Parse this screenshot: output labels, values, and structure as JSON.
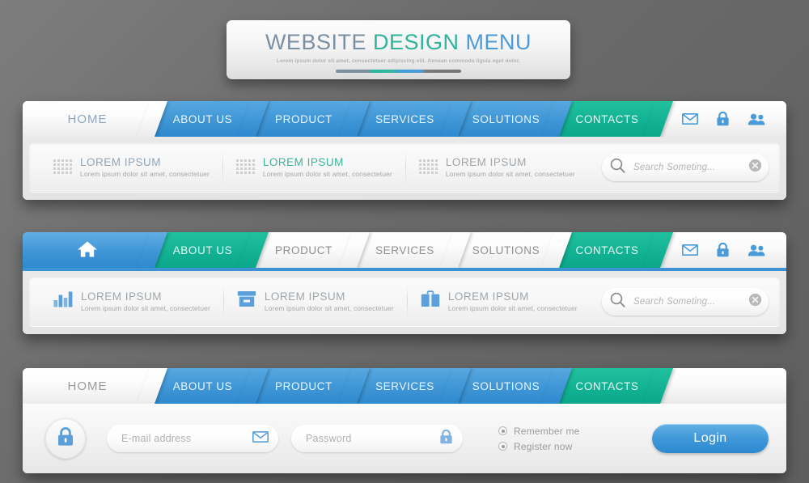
{
  "header": {
    "title_parts": [
      {
        "text": "WEBSITE",
        "cls": "t-website"
      },
      {
        "text": "DESIGN",
        "cls": "t-design"
      },
      {
        "text": "MENU",
        "cls": "t-menu-m"
      }
    ],
    "title_website": "WEBSITE",
    "title_design": "DESIGN",
    "title_menu": "MENU",
    "subtitle": "Lorem ipsum dolor sit amet, consectetuer adipiscing elit. Aenean commodo ligula eget dolor."
  },
  "colors": {
    "blue": "#3f96d6",
    "teal": "#13b294",
    "white_tab": "#fbfbfb",
    "page_bg": "#6e6e6e",
    "title_blue_gray": "#7b8fa3",
    "title_teal": "#2fb49a",
    "muted_text": "#a7a7a7"
  },
  "bar1": {
    "tabs": [
      {
        "label": "HOME",
        "style": "home-light"
      },
      {
        "label": "ABOUT US",
        "style": "blue"
      },
      {
        "label": "PRODUCT",
        "style": "blue"
      },
      {
        "label": "SERVICES",
        "style": "blue"
      },
      {
        "label": "SOLUTIONS",
        "style": "blue"
      },
      {
        "label": "CONTACTS",
        "style": "teal"
      }
    ],
    "icons": [
      "envelope-icon",
      "lock-icon",
      "users-icon"
    ],
    "features": [
      {
        "icon": "dot-grid-icon",
        "title": "LOREM IPSUM",
        "subtitle": "Lorem ipsum dolor sit amet, consectetuer",
        "color": "blue"
      },
      {
        "icon": "dot-grid-icon",
        "title": "LOREM IPSUM",
        "subtitle": "Lorem ipsum dolor sit amet, consectetuer",
        "color": "teal"
      },
      {
        "icon": "dot-grid-icon",
        "title": "LOREM IPSUM",
        "subtitle": "Lorem ipsum dolor sit amet, consectetuer",
        "color": "gray"
      }
    ],
    "search": {
      "placeholder": "Search Someting...",
      "value": ""
    }
  },
  "bar2": {
    "tabs": [
      {
        "label": "",
        "style": "home-blue",
        "icon": "home-icon"
      },
      {
        "label": "ABOUT US",
        "style": "teal"
      },
      {
        "label": "PRODUCT",
        "style": "white"
      },
      {
        "label": "SERVICES",
        "style": "white"
      },
      {
        "label": "SOLUTIONS",
        "style": "white"
      },
      {
        "label": "CONTACTS",
        "style": "teal"
      }
    ],
    "icons": [
      "envelope-icon",
      "lock-icon",
      "users-icon"
    ],
    "features": [
      {
        "icon": "bar-chart-icon",
        "title": "LOREM IPSUM",
        "subtitle": "Lorem ipsum dolor sit amet, consectetuer",
        "color": "gray"
      },
      {
        "icon": "archive-box-icon",
        "title": "LOREM IPSUM",
        "subtitle": "Lorem ipsum dolor sit amet, consectetuer",
        "color": "gray"
      },
      {
        "icon": "briefcase-icon",
        "title": "LOREM IPSUM",
        "subtitle": "Lorem ipsum dolor sit amet, consectetuer",
        "color": "gray"
      }
    ],
    "search": {
      "placeholder": "Search Someting...",
      "value": ""
    }
  },
  "bar3": {
    "tabs": [
      {
        "label": "HOME",
        "style": "home-light2"
      },
      {
        "label": "ABOUT US",
        "style": "blue"
      },
      {
        "label": "PRODUCT",
        "style": "blue"
      },
      {
        "label": "SERVICES",
        "style": "blue"
      },
      {
        "label": "SOLUTIONS",
        "style": "blue"
      },
      {
        "label": "CONTACTS",
        "style": "teal"
      }
    ],
    "login": {
      "lock_icon": "lock-icon",
      "email": {
        "placeholder": "E-mail address",
        "value": "",
        "icon": "envelope-icon"
      },
      "password": {
        "placeholder": "Password",
        "value": "",
        "icon": "lock-icon"
      },
      "options": [
        {
          "label": "Remember me",
          "selected": true
        },
        {
          "label": "Register now",
          "selected": true
        }
      ],
      "submit_label": "Login"
    }
  }
}
